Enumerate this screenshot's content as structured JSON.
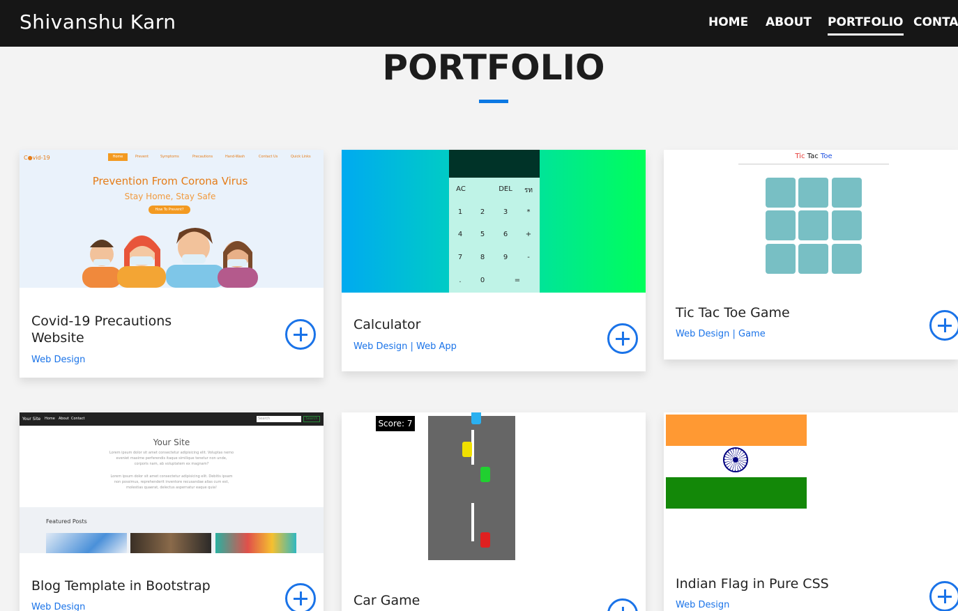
{
  "navbar": {
    "brand": "Shivanshu Karn",
    "links": [
      "HOME",
      "ABOUT",
      "PORTFOLIO",
      "CONTACT"
    ],
    "active": "PORTFOLIO"
  },
  "section": {
    "title": "PORTFOLIO",
    "accent_color": "#0b78e3"
  },
  "projects": [
    {
      "title_line1": "Covid-19 Precautions",
      "title_line2": "Website",
      "tags": "Web Design",
      "thumb": {
        "logo": "C●vid-19",
        "nav": [
          "Home",
          "Prevent",
          "Symptoms",
          "Precautions",
          "Hand-Wash",
          "Contact Us",
          "Quick Links"
        ],
        "heading": "Prevention From Corona Virus",
        "subheading": "Stay Home, Stay Safe",
        "button": "How To Prevent?"
      }
    },
    {
      "title": "Calculator",
      "tags": "Web Design | Web App",
      "thumb": {
        "keys": [
          "AC",
          "DEL",
          "รท",
          "1",
          "2",
          "3",
          "*",
          "4",
          "5",
          "6",
          "+",
          "7",
          "8",
          "9",
          "-",
          ".",
          "0",
          "="
        ]
      }
    },
    {
      "title": "Tic Tac Toe Game",
      "tags": "Web Design | Game",
      "thumb": {
        "heading_tic": "Tic",
        "heading_tac": "Tac",
        "heading_toe": "Toe"
      }
    },
    {
      "title": "Blog Template in Bootstrap",
      "tags": "Web Design",
      "thumb": {
        "brand": "Your Site",
        "nav": [
          "Home",
          "About",
          "Contact"
        ],
        "search_placeholder": "Search",
        "search_button": "Search",
        "hero_title": "Your Site",
        "para1": "Lorem ipsum dolor sit amet consectetur adipisicing elit. Voluptas nemo eveniet maxime perferendis itaque similique tenetur non unde, corporis nam, ab voluptatem ex magnam?",
        "para2": "Lorem ipsum dolor sit amet consectetur adipisicing elit. Debitis ipsam non possimus, reprehenderit inventore recusandae alias cum est, molestias quaerat, delectus aspernatur eaque quia!",
        "featured": "Featured Posts"
      }
    },
    {
      "title": "Car Game",
      "tags": "",
      "thumb": {
        "score": "Score: 7"
      }
    },
    {
      "title": "Indian Flag in Pure CSS",
      "tags": "Web Design",
      "thumb": {
        "colors": [
          "#ff9933",
          "#ffffff",
          "#138808"
        ]
      }
    }
  ]
}
